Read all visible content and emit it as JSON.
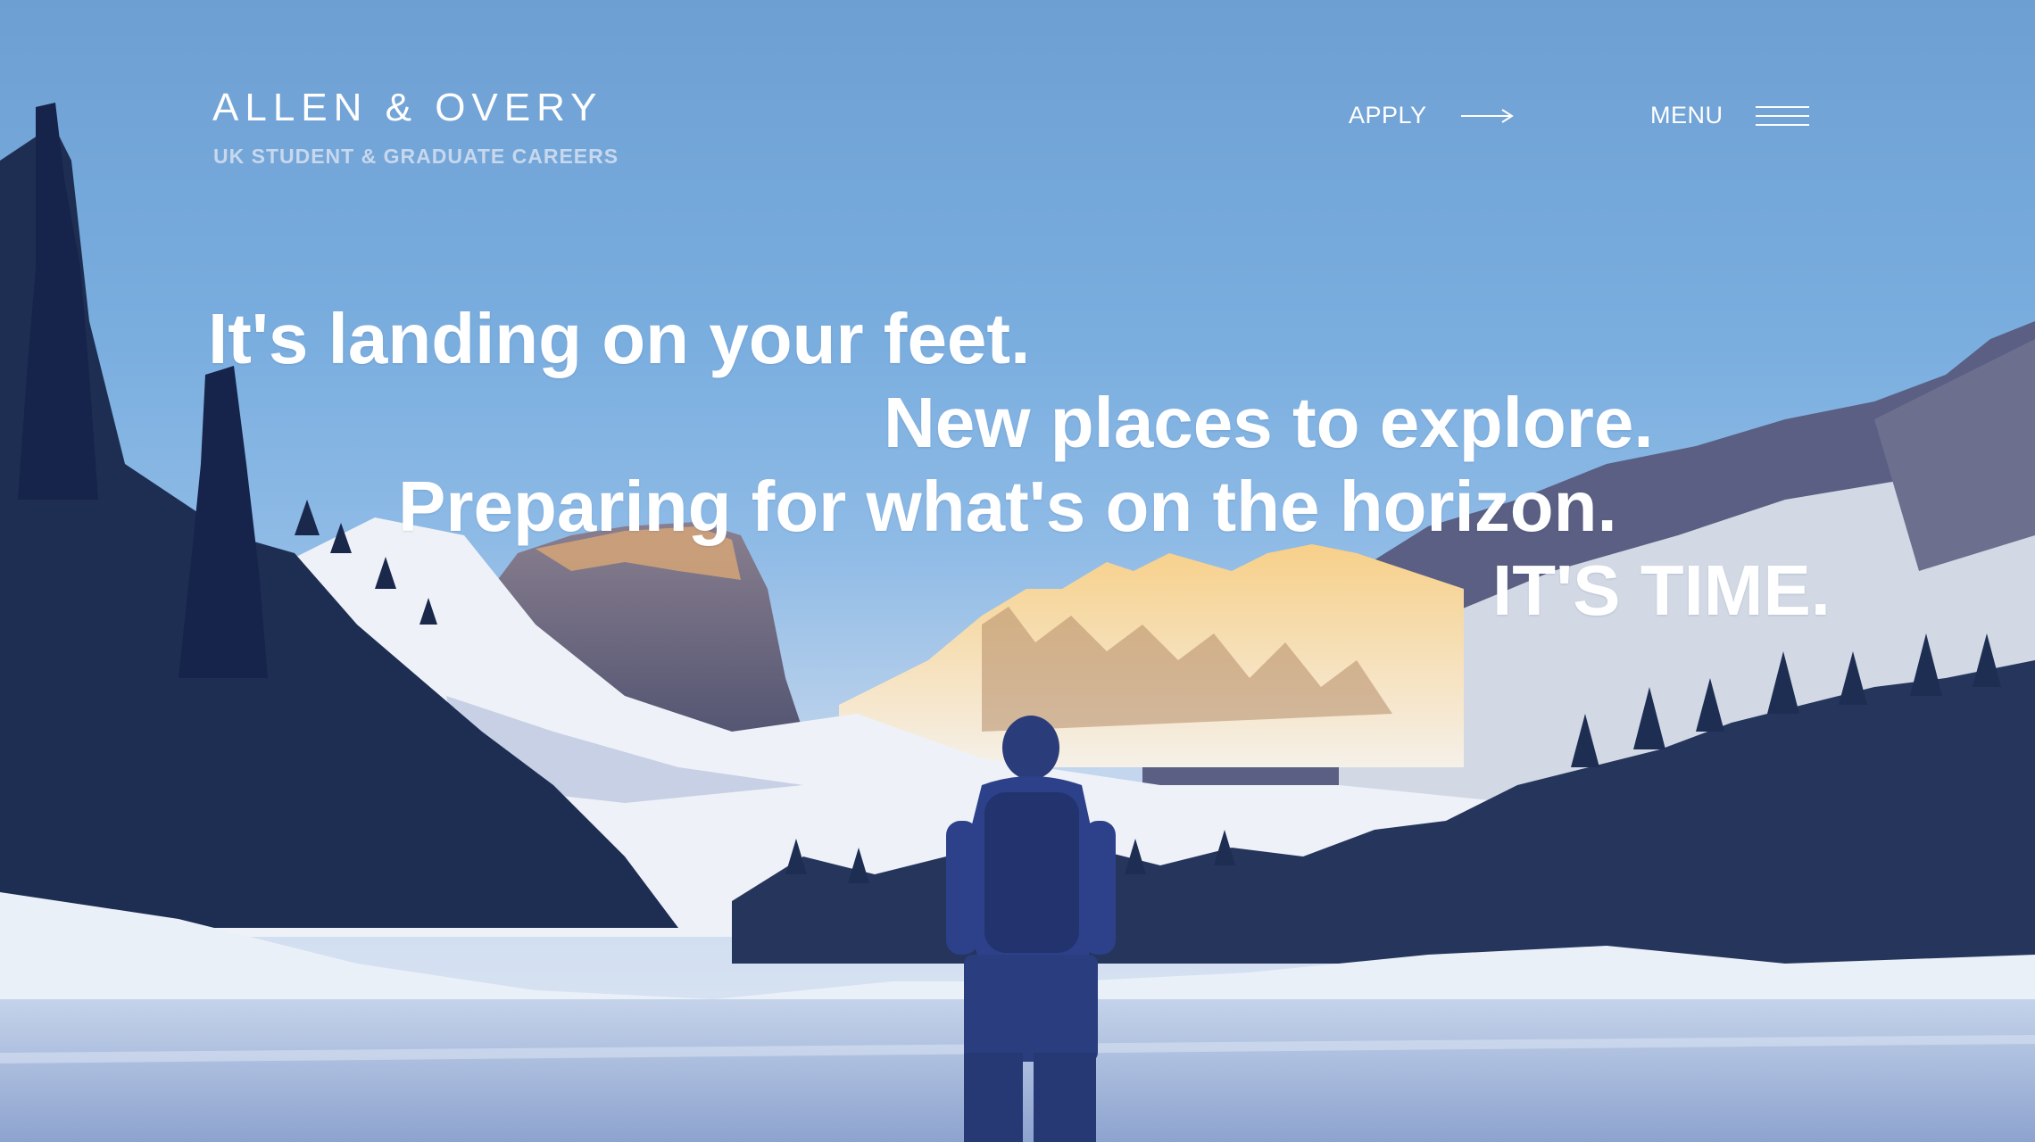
{
  "header": {
    "brand_name": "ALLEN & OVERY",
    "brand_tagline": "UK STUDENT & GRADUATE CAREERS",
    "apply_label": "APPLY",
    "apply_icon": "arrow-right-icon",
    "menu_label": "MENU",
    "menu_icon": "hamburger-icon"
  },
  "hero": {
    "line1": "It's landing on your feet.",
    "line2": "New places to explore.",
    "line3": "Preparing for what's on the horizon.",
    "line4": "IT'S TIME."
  },
  "colors": {
    "sky": "#75a8dc",
    "text": "#ffffff",
    "tagline": "#c7d8ee",
    "snow": "#dfe8f4",
    "forest": "#1e2e52",
    "sunlit_peak": "#f0c27a"
  }
}
